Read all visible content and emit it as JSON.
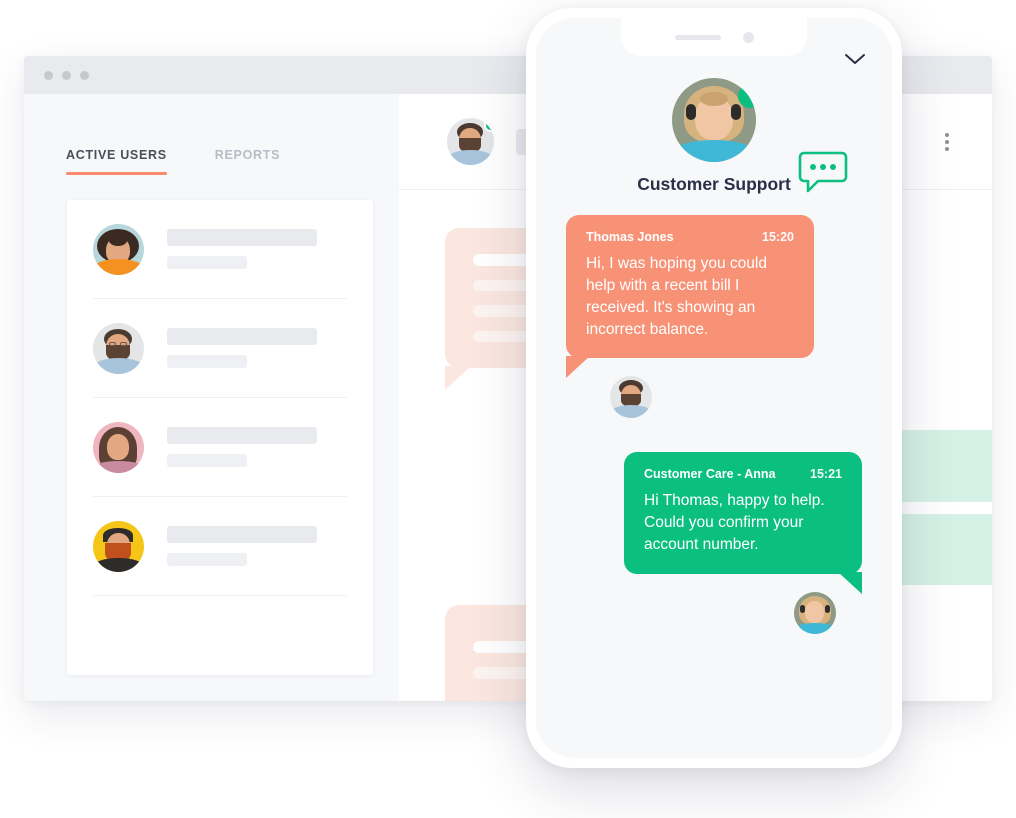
{
  "window": {
    "traffic_lights": [
      "close",
      "minimize",
      "maximize"
    ],
    "left_panel": {
      "tabs": [
        {
          "label": "ACTIVE USERS",
          "active": true
        },
        {
          "label": "REPORTS",
          "active": false
        }
      ],
      "user_rows": [
        {
          "avatar": "woman-curly-hair-avatar"
        },
        {
          "avatar": "man-beard-glasses-avatar"
        },
        {
          "avatar": "woman-long-hair-avatar"
        },
        {
          "avatar": "man-red-beard-avatar"
        }
      ]
    },
    "right_panel": {
      "header_avatar": "man-beard-glasses-avatar",
      "online": true,
      "more_menu": "kebab-menu-icon",
      "ghost_bubbles": [
        {
          "kind": "incoming",
          "color": "#fbe7df",
          "lines": 4
        },
        {
          "kind": "outgoing",
          "color": "#d6f1e5",
          "lines": 1
        },
        {
          "kind": "incoming",
          "color": "#fbe7df",
          "lines": 2
        }
      ]
    }
  },
  "phone": {
    "notch": {
      "speaker": "speaker-grille",
      "camera": "front-camera"
    },
    "collapse_icon": "chevron-down-icon",
    "header": {
      "avatar": "support-agent-anna-avatar",
      "online": true,
      "title": "Customer Support",
      "typing_icon": "chat-bubble-dots-icon"
    },
    "messages": [
      {
        "author": "Thomas Jones",
        "time": "15:20",
        "text": "Hi, I was hoping you could help with a recent bill I received. It's showing an incorrect balance.",
        "side": "left",
        "color": "#f79277",
        "avatar": "man-beard-glasses-avatar"
      },
      {
        "author": "Customer Care - Anna",
        "time": "15:21",
        "text": "Hi Thomas, happy to help. Could you confirm your account number.",
        "side": "right",
        "color": "#0abf7f",
        "avatar": "support-agent-anna-avatar"
      }
    ]
  },
  "colors": {
    "accent_orange": "#f79277",
    "accent_green": "#0abf7f",
    "tab_underline": "#f78b6c",
    "panel_bg": "#f6f8fa",
    "skeleton": "#e9eaee"
  }
}
